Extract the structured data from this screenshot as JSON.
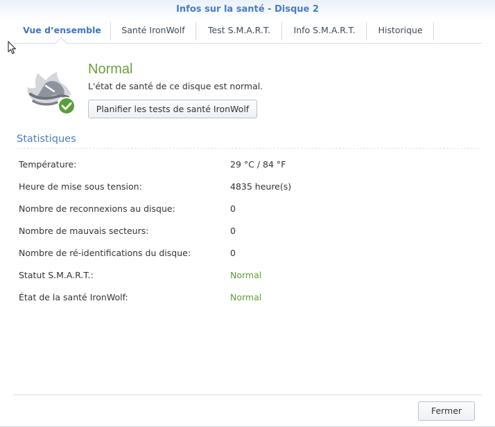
{
  "window": {
    "title": "Infos sur la santé - Disque 2"
  },
  "tabs": [
    {
      "label": "Vue d’ensemble",
      "active": true
    },
    {
      "label": "Santé IronWolf",
      "active": false
    },
    {
      "label": "Test S.M.A.R.T.",
      "active": false
    },
    {
      "label": "Info S.M.A.R.T.",
      "active": false
    },
    {
      "label": "Historique",
      "active": false
    }
  ],
  "status": {
    "title": "Normal",
    "description": "L'état de santé de ce disque est normal.",
    "schedule_button": "Planifier les tests de santé IronWolf",
    "icon": "ironwolf-ok-icon",
    "color": "#6a9f3b"
  },
  "statistics": {
    "title": "Statistiques",
    "rows": [
      {
        "label": "Température:",
        "value": "29 °C / 84 °F",
        "status": false
      },
      {
        "label": "Heure de mise sous tension:",
        "value": "4835 heure(s)",
        "status": false
      },
      {
        "label": "Nombre de reconnexions au disque:",
        "value": "0",
        "status": false
      },
      {
        "label": "Nombre de mauvais secteurs:",
        "value": "0",
        "status": false
      },
      {
        "label": "Nombre de ré-identifications du disque:",
        "value": "0",
        "status": false
      },
      {
        "label": "Statut S.M.A.R.T.:",
        "value": "Normal",
        "status": true
      },
      {
        "label": "État de la santé IronWolf:",
        "value": "Normal",
        "status": true
      }
    ]
  },
  "footer": {
    "close_button": "Fermer"
  }
}
